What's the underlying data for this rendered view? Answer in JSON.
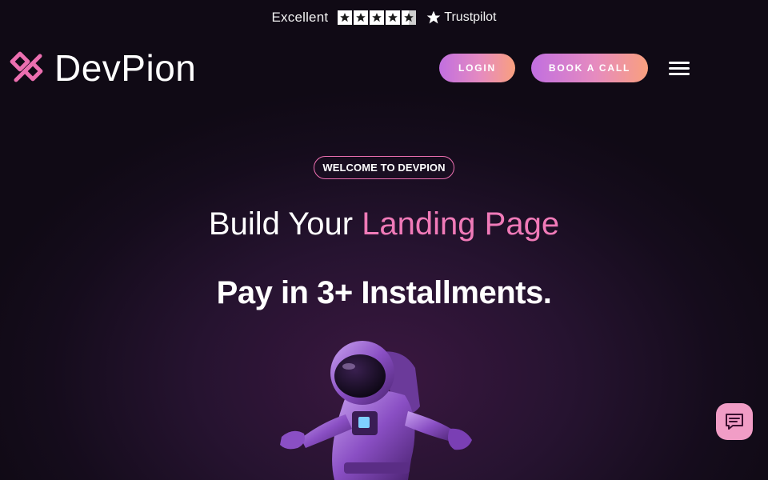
{
  "trustpilot": {
    "rating_label": "Excellent",
    "stars": 4.5,
    "brand": "Trustpilot"
  },
  "header": {
    "logo_text": "DevPion",
    "login_label": "LOGIN",
    "book_call_label": "BOOK A CALL",
    "menu_icon": "hamburger-menu-icon"
  },
  "hero": {
    "badge": "WELCOME TO DEVPION",
    "headline_plain": "Build Your ",
    "headline_highlight": "Landing Page",
    "subheadline": "Pay in 3+ Installments."
  },
  "chat": {
    "icon": "chat-bubble-icon"
  },
  "colors": {
    "accent_pink": "#f07ab8",
    "button_gradient_start": "#c16fe0",
    "button_gradient_end": "#f9a07e",
    "background": "#150c1c",
    "chat_button": "#f19dc6"
  }
}
